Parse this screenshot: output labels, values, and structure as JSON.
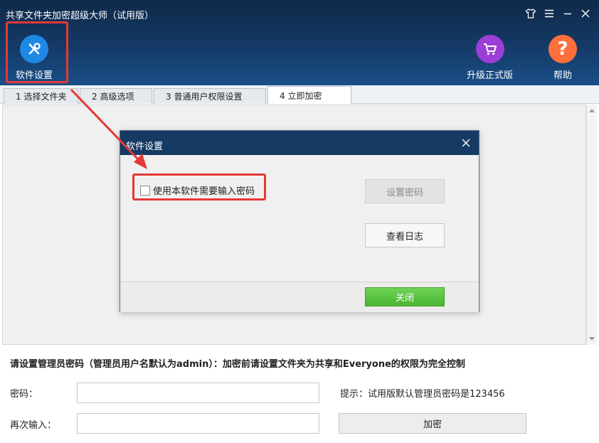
{
  "window": {
    "title": "共享文件夹加密超级大师（试用版）",
    "controls": [
      "shirt-icon",
      "menu-icon",
      "minimize-icon",
      "close-icon"
    ]
  },
  "toolbar": {
    "settings_label": "软件设置",
    "upgrade_label": "升级正式版",
    "help_label": "帮助",
    "colors": {
      "settings": "#1e88e5",
      "upgrade": "#9b3fd6",
      "help": "#ff6f3c"
    }
  },
  "tabs": [
    {
      "label": "1 选择文件夹"
    },
    {
      "label": "2 高级选项"
    },
    {
      "label": "3 普通用户权限设置"
    },
    {
      "label": "4 立即加密"
    }
  ],
  "dialog": {
    "title": "软件设置",
    "checkbox_label": "使用本软件需要输入密码",
    "set_password_label": "设置密码",
    "view_log_label": "查看日志",
    "close_label": "关闭"
  },
  "bottom": {
    "hint": "请设置管理员密码（管理员用户名默认为admin）：加密前请设置文件夹为共享和Everyone的权限为完全控制",
    "password_label": "密码：",
    "confirm_label": "再次输入：",
    "password_value": "",
    "confirm_value": "",
    "tip": "提示：试用版默认管理员密码是123456",
    "encrypt_label": "加密"
  }
}
